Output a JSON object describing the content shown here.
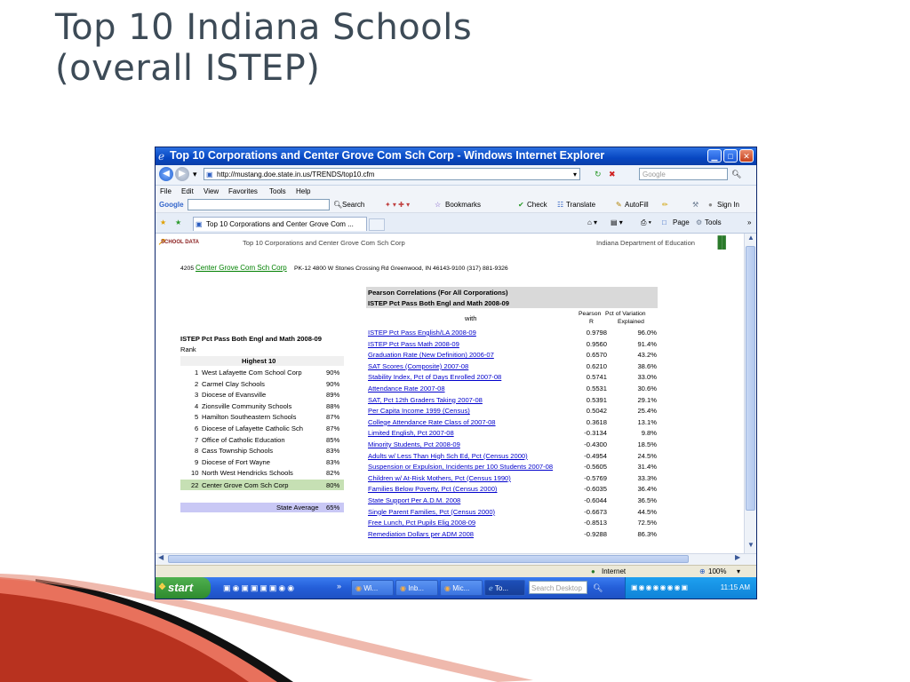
{
  "slide": {
    "title_line1": "Top 10 Indiana Schools",
    "title_line2": "(overall ISTEP)"
  },
  "window": {
    "title": "Top 10 Corporations and Center Grove Com Sch Corp - Windows Internet Explorer",
    "url": "http://mustang.doe.state.in.us/TRENDS/top10.cfm",
    "search_placeholder": "Google",
    "menu": [
      "File",
      "Edit",
      "View",
      "Favorites",
      "Tools",
      "Help"
    ],
    "google_label": "Google",
    "google_toolbar": [
      "Search",
      "Bookmarks",
      "Check",
      "Translate",
      "AutoFill",
      "Sign In"
    ],
    "tab_label": "Top 10 Corporations and Center Grove Com ...",
    "tab_tools": [
      "Page",
      "Tools"
    ],
    "status_zone": "Internet",
    "zoom": "100%"
  },
  "taskbar": {
    "start": "start",
    "items": [
      "Wi...",
      "Inb...",
      "Mic...",
      "To..."
    ],
    "desktop_search": "Search Desktop",
    "clock": "11:15 AM"
  },
  "page": {
    "brand": "School Data",
    "header_title": "Top 10 Corporations and Center Grove Com Sch Corp",
    "header_right": "Indiana Department of Education",
    "corp_number": "4205",
    "corp_name": "Center Grove Com Sch Corp",
    "corp_details": "PK-12   4800 W Stones Crossing Rd   Greenwood, IN 46143-9100   (317) 881-9326",
    "ranking": {
      "title": "ISTEP Pct Pass Both Engl and Math 2008-09",
      "rank_label": "Rank",
      "highest_label": "Highest 10",
      "rows": [
        {
          "rank": "1",
          "name": "West Lafayette Com School Corp",
          "value": "90%"
        },
        {
          "rank": "2",
          "name": "Carmel Clay Schools",
          "value": "90%"
        },
        {
          "rank": "3",
          "name": "Diocese of Evansville",
          "value": "89%"
        },
        {
          "rank": "4",
          "name": "Zionsville Community Schools",
          "value": "88%"
        },
        {
          "rank": "5",
          "name": "Hamilton Southeastern Schools",
          "value": "87%"
        },
        {
          "rank": "6",
          "name": "Diocese of Lafayette Catholic Sch",
          "value": "87%"
        },
        {
          "rank": "7",
          "name": "Office of Catholic Education",
          "value": "85%"
        },
        {
          "rank": "8",
          "name": "Cass Township Schools",
          "value": "83%"
        },
        {
          "rank": "9",
          "name": "Diocese of Fort Wayne",
          "value": "83%"
        },
        {
          "rank": "10",
          "name": "North West Hendricks Schools",
          "value": "82%"
        },
        {
          "rank": "22",
          "name": "Center Grove Com Sch Corp",
          "value": "80%"
        }
      ],
      "state_average_label": "State Average",
      "state_average_value": "65%"
    },
    "correlations": {
      "title": "Pearson Correlations (For All Corporations)",
      "subtitle": "ISTEP Pct Pass Both Engl and Math 2008-09",
      "with_label": "with",
      "col_r_line1": "Pearson",
      "col_r_line2": "R",
      "col_v_line1": "Pct of Variation",
      "col_v_line2": "Explained",
      "rows": [
        {
          "label": "ISTEP Pct Pass English/LA 2008-09",
          "r": "0.9798",
          "pct": "96.0%"
        },
        {
          "label": "ISTEP Pct Pass Math 2008-09",
          "r": "0.9560",
          "pct": "91.4%"
        },
        {
          "label": "Graduation Rate (New Definition) 2006-07",
          "r": "0.6570",
          "pct": "43.2%"
        },
        {
          "label": "SAT Scores (Composite) 2007-08",
          "r": "0.6210",
          "pct": "38.6%"
        },
        {
          "label": "Stability Index, Pct of Days Enrolled 2007-08",
          "r": "0.5741",
          "pct": "33.0%"
        },
        {
          "label": "Attendance Rate 2007-08",
          "r": "0.5531",
          "pct": "30.6%"
        },
        {
          "label": "SAT, Pct 12th Graders Taking 2007-08",
          "r": "0.5391",
          "pct": "29.1%"
        },
        {
          "label": "Per Capita Income 1999 (Census)",
          "r": "0.5042",
          "pct": "25.4%"
        },
        {
          "label": "College Attendance Rate Class of 2007-08",
          "r": "0.3618",
          "pct": "13.1%"
        },
        {
          "label": "Limited English, Pct 2007-08",
          "r": "-0.3134",
          "pct": "9.8%"
        },
        {
          "label": "Minority Students, Pct 2008-09",
          "r": "-0.4300",
          "pct": "18.5%"
        },
        {
          "label": "Adults w/ Less Than High Sch Ed, Pct (Census 2000)",
          "r": "-0.4954",
          "pct": "24.5%"
        },
        {
          "label": "Suspension or Expulsion, Incidents per 100 Students 2007-08",
          "r": "-0.5605",
          "pct": "31.4%"
        },
        {
          "label": "Children w/ At-Risk Mothers, Pct (Census 1990)",
          "r": "-0.5769",
          "pct": "33.3%"
        },
        {
          "label": "Families Below Poverty, Pct (Census 2000)",
          "r": "-0.6035",
          "pct": "36.4%"
        },
        {
          "label": "State Support Per A.D.M. 2008",
          "r": "-0.6044",
          "pct": "36.5%"
        },
        {
          "label": "Single Parent Families, Pct (Census 2000)",
          "r": "-0.6673",
          "pct": "44.5%"
        },
        {
          "label": "Free Lunch, Pct Pupils Elig 2008-09",
          "r": "-0.8513",
          "pct": "72.5%"
        },
        {
          "label": "Remediation Dollars per ADM 2008",
          "r": "-0.9288",
          "pct": "86.3%"
        }
      ]
    }
  },
  "colors": {
    "title_text": "#3d4b57",
    "deco_red": "#c0392b",
    "link": "#0000cc",
    "highlight_row": "#c6e0b4",
    "state_avg_row": "#c9c8f5",
    "header_gray": "#d9d9d9"
  }
}
